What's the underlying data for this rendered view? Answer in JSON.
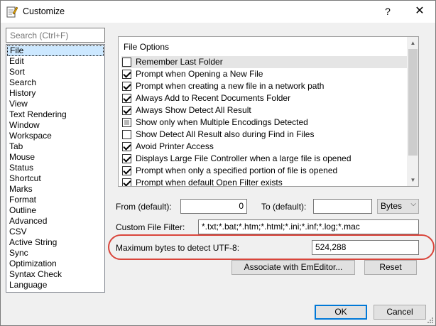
{
  "window": {
    "title": "Customize",
    "help": "?",
    "close": "✕"
  },
  "search": {
    "placeholder": "Search (Ctrl+F)"
  },
  "categories": [
    "File",
    "Edit",
    "Sort",
    "Search",
    "History",
    "View",
    "Text Rendering",
    "Window",
    "Workspace",
    "Tab",
    "Mouse",
    "Status",
    "Shortcut",
    "Marks",
    "Format",
    "Outline",
    "Advanced",
    "CSV",
    "Active String",
    "Sync",
    "Optimization",
    "Syntax Check",
    "Language"
  ],
  "selected_category": "File",
  "file_options": {
    "header": "File Options",
    "items": [
      {
        "label": "Remember Last Folder",
        "state": "unchecked"
      },
      {
        "label": "Prompt when Opening a New File",
        "state": "checked"
      },
      {
        "label": "Prompt when creating a new file in a network path",
        "state": "checked"
      },
      {
        "label": "Always Add to Recent Documents Folder",
        "state": "checked"
      },
      {
        "label": "Always Show Detect All Result",
        "state": "checked"
      },
      {
        "label": "Show only when Multiple Encodings Detected",
        "state": "indeterminate"
      },
      {
        "label": "Show Detect All Result also during Find in Files",
        "state": "unchecked"
      },
      {
        "label": "Avoid Printer Access",
        "state": "checked"
      },
      {
        "label": "Displays Large File Controller when a large file is opened",
        "state": "checked"
      },
      {
        "label": "Prompt when only a specified portion of file is opened",
        "state": "checked"
      },
      {
        "label": "Prompt when default Open Filter exists",
        "state": "checked"
      }
    ]
  },
  "range": {
    "from_label": "From (default):",
    "from_value": "0",
    "to_label": "To (default):",
    "to_value": "",
    "unit": "Bytes"
  },
  "filter": {
    "label": "Custom File Filter:",
    "value": "*.txt;*.bat;*.htm;*.html;*.ini;*.inf;*.log;*.mac"
  },
  "utf8": {
    "label": "Maximum bytes to detect UTF-8:",
    "value": "524,288"
  },
  "buttons": {
    "associate": "Associate with EmEditor...",
    "reset": "Reset",
    "ok": "OK",
    "cancel": "Cancel"
  },
  "colors": {
    "highlight_oval": "#d9453b",
    "selection": "#cce8ff",
    "default_button_border": "#0078d7"
  }
}
